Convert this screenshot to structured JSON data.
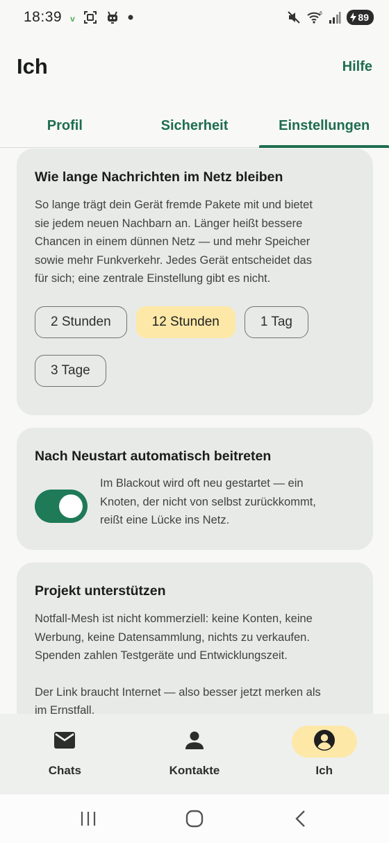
{
  "status_bar": {
    "time": "18:39",
    "carrier_mark": "v",
    "battery_level": "89",
    "icons": [
      "screenshot-icon",
      "robot-icon",
      "notification-dot-icon",
      "mute-icon",
      "wifi-icon",
      "signal-icon",
      "battery-charging-icon"
    ]
  },
  "header": {
    "title": "Ich",
    "help_label": "Hilfe"
  },
  "tabs": [
    {
      "label": "Profil",
      "active": false
    },
    {
      "label": "Sicherheit",
      "active": false
    },
    {
      "label": "Einstellungen",
      "active": true
    }
  ],
  "retention_card": {
    "title": "Wie lange Nachrichten im Netz bleiben",
    "lines": [
      "So lange trägt dein Gerät fremde Pakete mit und bietet",
      "sie jedem neuen Nachbarn an. Länger heißt bessere",
      "Chancen in einem dünnen Netz — und mehr Speicher",
      "sowie mehr Funkverkehr. Jedes Gerät entscheidet das",
      "für sich; eine zentrale Einstellung gibt es nicht."
    ],
    "options": [
      {
        "label": "2 Stunden",
        "selected": false
      },
      {
        "label": "12 Stunden",
        "selected": true
      },
      {
        "label": "1 Tag",
        "selected": false
      },
      {
        "label": "3 Tage",
        "selected": false
      }
    ]
  },
  "autojoin_card": {
    "title": "Nach Neustart automatisch beitreten",
    "toggle_on": true,
    "lines": [
      "Im Blackout wird oft neu gestartet — ein",
      "Knoten, der nicht von selbst zurückkommt,",
      "reißt eine Lücke ins Netz."
    ]
  },
  "support_card": {
    "title": "Projekt unterstützen",
    "lines": [
      "Notfall-Mesh ist nicht kommerziell: keine Konten, keine",
      "Werbung, keine Datensammlung, nichts zu verkaufen.",
      "Spenden zahlen Testgeräte und Entwicklungszeit."
    ],
    "lines2": [
      "Der Link braucht Internet — also besser jetzt merken als",
      "im Ernstfall."
    ]
  },
  "bottom_nav": [
    {
      "label": "Chats",
      "icon": "mail-icon",
      "active": false
    },
    {
      "label": "Kontakte",
      "icon": "person-icon",
      "active": false
    },
    {
      "label": "Ich",
      "icon": "account-circle-icon",
      "active": true
    }
  ],
  "colors": {
    "accent": "#1e6e4e",
    "selected_chip": "#fde8a8",
    "card_bg": "#e8eae8",
    "toggle_on": "#1e7a57"
  }
}
